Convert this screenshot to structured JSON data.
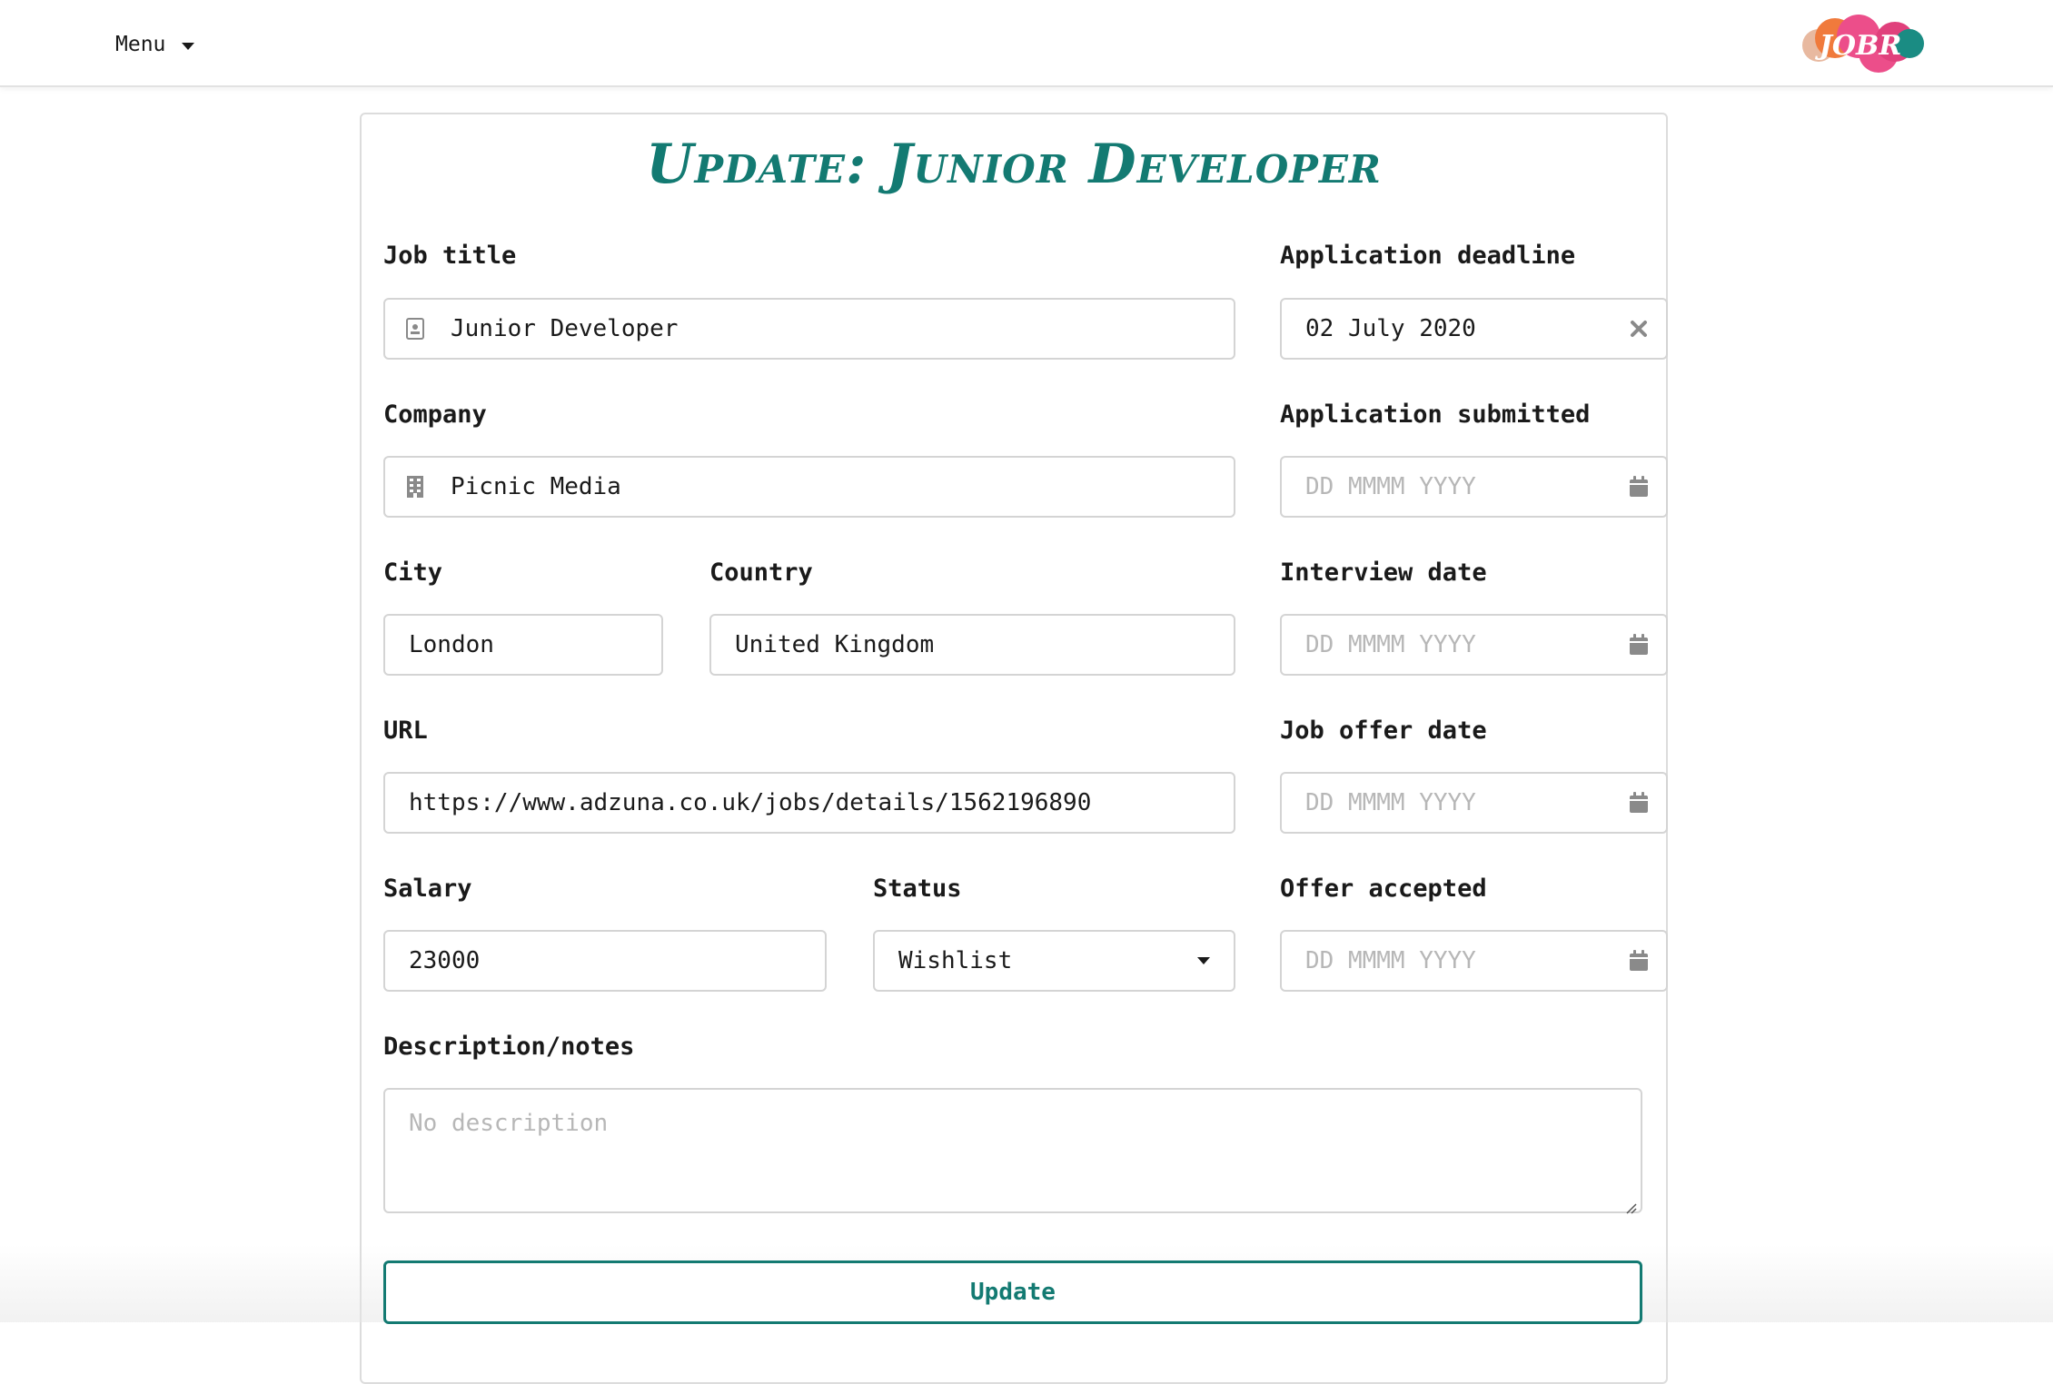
{
  "nav": {
    "menu_label": "Menu",
    "logo_text": "JOBR"
  },
  "page": {
    "title": "Update: Junior Developer"
  },
  "form": {
    "job_title": {
      "label": "Job title",
      "value": "Junior Developer",
      "icon": "id-card-icon"
    },
    "company": {
      "label": "Company",
      "value": "Picnic Media",
      "icon": "building-icon"
    },
    "city": {
      "label": "City",
      "value": "London"
    },
    "country": {
      "label": "Country",
      "value": "United Kingdom"
    },
    "url": {
      "label": "URL",
      "value": "https://www.adzuna.co.uk/jobs/details/1562196890"
    },
    "salary": {
      "label": "Salary",
      "value": "23000"
    },
    "status": {
      "label": "Status",
      "value": "Wishlist"
    },
    "description": {
      "label": "Description/notes",
      "placeholder": "No description"
    },
    "application_deadline": {
      "label": "Application deadline",
      "value": "02 July 2020",
      "icon": "clear-x-icon"
    },
    "application_submitted": {
      "label": "Application submitted",
      "placeholder": "DD MMMM YYYY",
      "icon": "calendar-icon"
    },
    "interview_date": {
      "label": "Interview date",
      "placeholder": "DD MMMM YYYY",
      "icon": "calendar-icon"
    },
    "job_offer_date": {
      "label": "Job offer date",
      "placeholder": "DD MMMM YYYY",
      "icon": "calendar-icon"
    },
    "offer_accepted": {
      "label": "Offer accepted",
      "placeholder": "DD MMMM YYYY",
      "icon": "calendar-icon"
    },
    "submit_label": "Update"
  },
  "colors": {
    "accent": "#137a72",
    "logo_pink": "#ec4e8a",
    "logo_orange": "#f07a3c",
    "logo_peach": "#e8b9a0",
    "logo_teal": "#1a8c83"
  }
}
